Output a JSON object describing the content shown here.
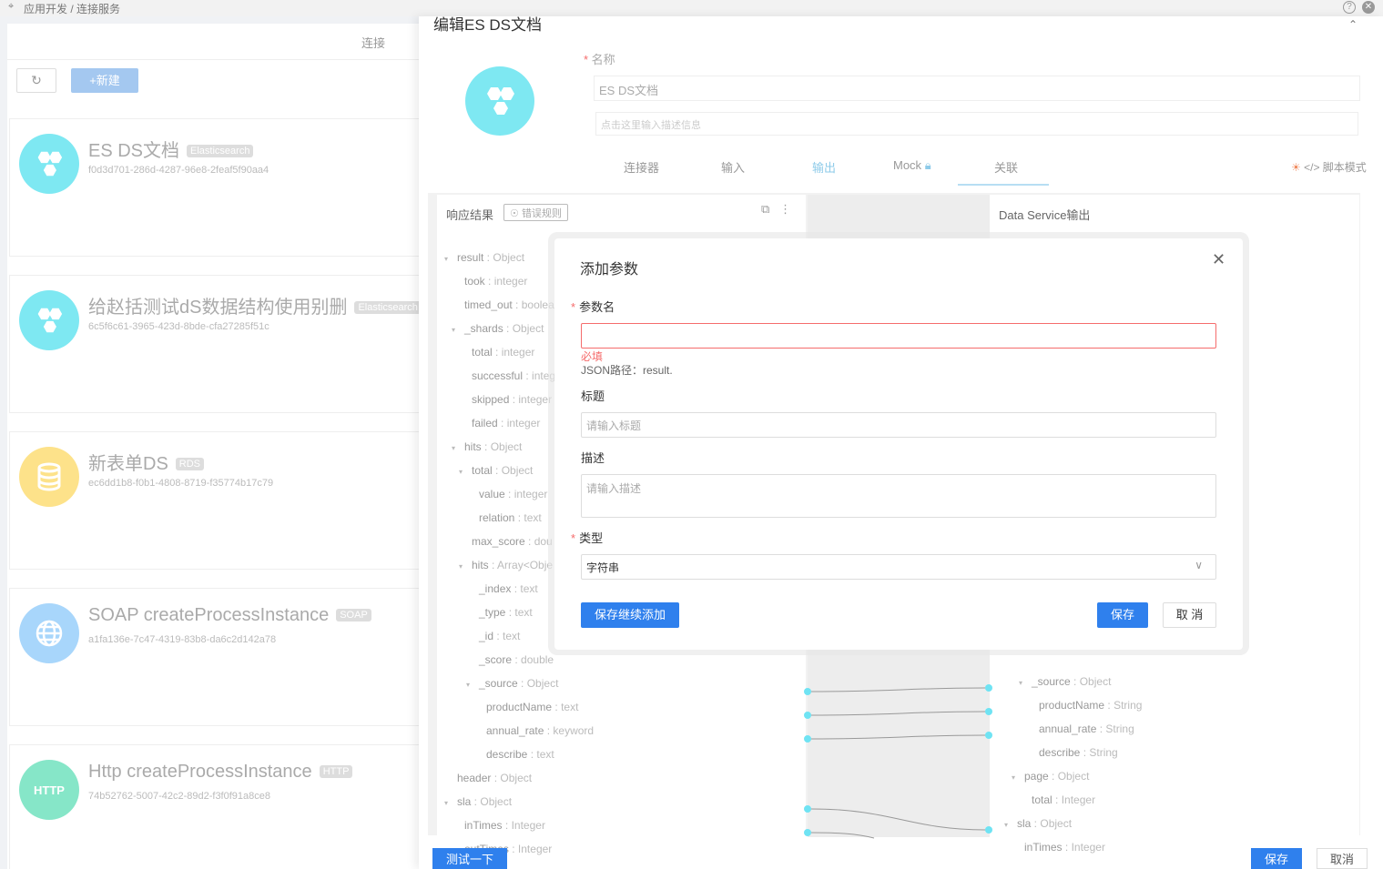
{
  "breadcrumb": "应用开发 / 连接服务",
  "left": {
    "header": "连接",
    "new_label": "新建",
    "cards": [
      {
        "title": "ES DS文档",
        "tag": "Elasticsearch",
        "id": "f0d3d701-286d-4287-96e8-2feaf5f90aa4",
        "color": "#7ee8f2",
        "icon": "hexagon-cluster-icon"
      },
      {
        "title": "给赵括测试dS数据结构使用别删",
        "tag": "Elasticsearch",
        "id": "6c5f6c61-3965-423d-8bde-cfa27285f51c",
        "color": "#7ee8f2",
        "icon": "hexagon-cluster-icon"
      },
      {
        "title": "新表单DS",
        "tag": "RDS",
        "id": "ec6dd1b8-f0b1-4808-8719-f35774b17c79",
        "color": "#fde28a",
        "icon": "database-icon"
      },
      {
        "title": "SOAP createProcessInstance",
        "tag": "SOAP",
        "id": "a1fa136e-7c47-4319-83b8-da6c2d142a78",
        "color": "#a8d6fb",
        "icon": "globe-icon"
      },
      {
        "title": "Http createProcessInstance",
        "tag": "HTTP",
        "id": "74b52762-5007-42c2-89d2-f3f0f91a8ce8",
        "color": "#86e6c8",
        "icon_text": "HTTP"
      }
    ]
  },
  "drawer": {
    "title": "编辑ES DS文档",
    "name_label": "名称",
    "name_value": "ES DS文档",
    "desc_placeholder": "点击这里输入描述信息",
    "tabs": [
      "连接器",
      "输入",
      "输出",
      "Mock",
      "关联"
    ],
    "active_tab": "输出",
    "script_mode": "</> 脚本模式",
    "resp_title": "响应结果",
    "error_rule": "错误规则",
    "out_title": "Data Service输出",
    "test_label": "测试一下",
    "save_label": "保存",
    "cancel_label": "取消"
  },
  "tree_left": [
    {
      "k": "result",
      "t": "Object"
    },
    {
      "k": "took",
      "t": "integer"
    },
    {
      "k": "timed_out",
      "t": "boolea"
    },
    {
      "k": "_shards",
      "t": "Object"
    },
    {
      "k": "total",
      "t": "integer"
    },
    {
      "k": "successful",
      "t": "integ"
    },
    {
      "k": "skipped",
      "t": "integer"
    },
    {
      "k": "failed",
      "t": "integer"
    },
    {
      "k": "hits",
      "t": "Object"
    },
    {
      "k": "total",
      "t": "Object"
    },
    {
      "k": "value",
      "t": "integer"
    },
    {
      "k": "relation",
      "t": "text"
    },
    {
      "k": "max_score",
      "t": "dou"
    },
    {
      "k": "hits",
      "t": "Array<Obje"
    },
    {
      "k": "_index",
      "t": "text"
    },
    {
      "k": "_type",
      "t": "text"
    },
    {
      "k": "_id",
      "t": "text"
    },
    {
      "k": "_score",
      "t": "double"
    },
    {
      "k": "_source",
      "t": "Object"
    },
    {
      "k": "productName",
      "t": "text"
    },
    {
      "k": "annual_rate",
      "t": "keyword"
    },
    {
      "k": "describe",
      "t": "text"
    },
    {
      "k": "header",
      "t": "Object"
    },
    {
      "k": "sla",
      "t": "Object"
    },
    {
      "k": "inTimes",
      "t": "Integer"
    },
    {
      "k": "outTimes",
      "t": "Integer"
    }
  ],
  "tree_right": [
    {
      "k": "_source",
      "t": "Object"
    },
    {
      "k": "productName",
      "t": "String"
    },
    {
      "k": "annual_rate",
      "t": "String"
    },
    {
      "k": "describe",
      "t": "String"
    },
    {
      "k": "page",
      "t": "Object"
    },
    {
      "k": "total",
      "t": "Integer"
    },
    {
      "k": "sla",
      "t": "Object"
    },
    {
      "k": "inTimes",
      "t": "Integer"
    }
  ],
  "modal": {
    "title": "添加参数",
    "param_name_label": "参数名",
    "required_msg": "必填",
    "json_path": "JSON路径：result.",
    "title_label": "标题",
    "title_placeholder": "请输入标题",
    "desc_label": "描述",
    "desc_placeholder": "请输入描述",
    "type_label": "类型",
    "type_value": "字符串",
    "save_continue": "保存继续添加",
    "save": "保存",
    "cancel": "取 消"
  }
}
